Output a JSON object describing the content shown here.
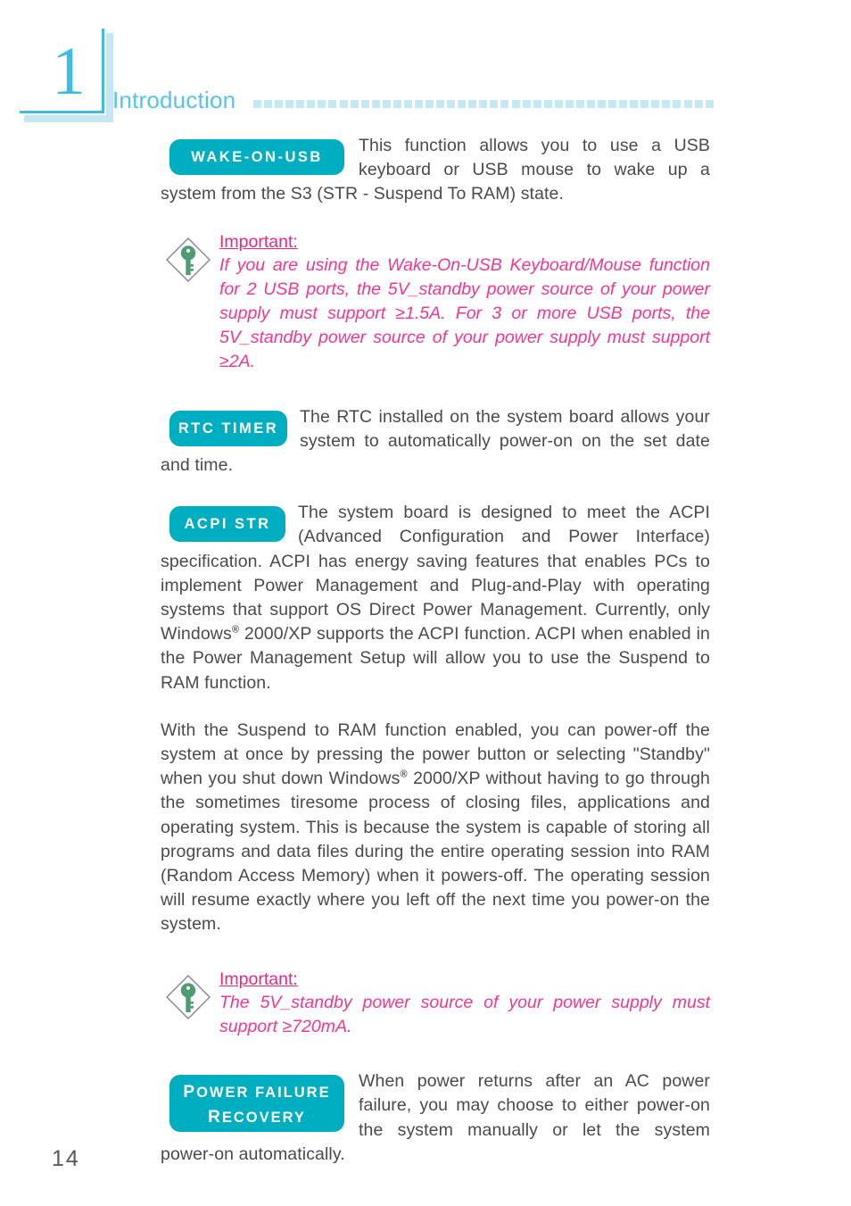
{
  "header": {
    "chapter_number": "1",
    "section_title": "Introduction",
    "dot_count": 43,
    "dot_color": "#c5e8f5",
    "title_color": "#54c4e8",
    "chapter_color": "#3fbde0",
    "chapter_shadow_color": "#c6e6f3"
  },
  "colors": {
    "badge_bg": "#00aec1",
    "badge_text": "#ffffff",
    "body_text": "#4a4a4a",
    "note_title": "#e8277f",
    "note_text": "#f4368f",
    "note_icon_key": "#4e9b74",
    "note_icon_outline": "#8b7f9e"
  },
  "sections": {
    "wake_on_usb": {
      "badge": "WAKE-ON-USB",
      "text": "This function allows you to use a USB keyboard or USB mouse to wake up a system from the S3 (STR - Suspend To RAM) state."
    },
    "note_1": {
      "title": "Important:",
      "text": "If you are using the Wake-On-USB Keyboard/Mouse function for 2 USB ports, the 5V_standby power source of your power supply must support ≥1.5A. For 3 or more USB ports, the 5V_standby power source of your power supply must support ≥2A."
    },
    "rtc_timer": {
      "badge": "RTC TIMER",
      "text": "The RTC installed on the system board allows your system to automatically power-on on the set date and time."
    },
    "acpi_str": {
      "badge": "ACPI STR",
      "text_part1": "The system board is designed to meet the ACPI (Advanced Configuration and Power Interface) specification. ACPI has energy saving features that enables PCs to implement Power Management and Plug-and-Play with operating systems that support OS Direct Power Management. Currently, only Windows",
      "registered_mark": "®",
      "text_part2": " 2000/XP supports the ACPI function. ACPI when enabled in the Power Management Setup will allow you to use the Suspend to RAM function."
    },
    "str_detail": {
      "text_part1": "With the Suspend to RAM function enabled, you can power-off the system at once by pressing the power button or selecting \"Standby\" when you shut down Windows",
      "registered_mark": "®",
      "text_part2": " 2000/XP without having to go through the sometimes tiresome process of closing files, applications and operating system. This is because the system is capable of storing all programs and data files during the entire operating session into RAM (Random Access Memory) when it powers-off. The operating session will resume exactly where you left off the next time you power-on the system."
    },
    "note_2": {
      "title": "Important:",
      "text": "The 5V_standby power source of your power supply must support ≥720mA."
    },
    "power_failure_recovery": {
      "badge_line1_cap": "P",
      "badge_line1_rest": "OWER FAILURE",
      "badge_line2_cap": "R",
      "badge_line2_rest": "ECOVERY",
      "text": "When power returns after an AC power failure, you may choose to either power-on the system manually or let the system power-on automatically."
    }
  },
  "footer": {
    "page_number": "14"
  }
}
